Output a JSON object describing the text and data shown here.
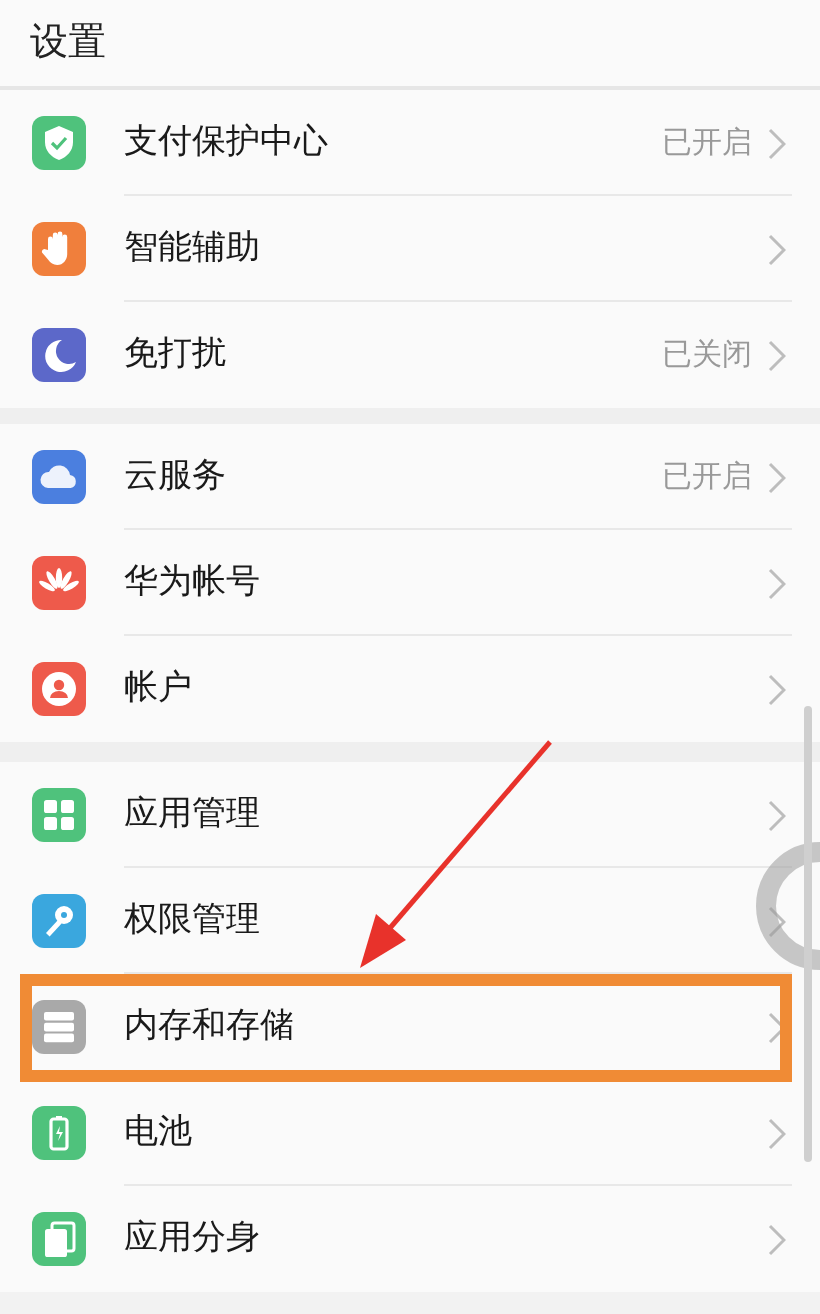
{
  "title": "设置",
  "groups": [
    {
      "items": [
        {
          "label": "支付保护中心",
          "status": "已开启",
          "kind": "shield",
          "color": "#4fc27c",
          "highlighted": false
        },
        {
          "label": "智能辅助",
          "kind": "hand",
          "color": "#f07f3c",
          "highlighted": false
        },
        {
          "label": "免打扰",
          "status": "已关闭",
          "kind": "moon",
          "color": "#5c68c9",
          "highlighted": false
        }
      ]
    },
    {
      "items": [
        {
          "label": "云服务",
          "status": "已开启",
          "kind": "cloud",
          "color": "#4b7fdf",
          "highlighted": false
        },
        {
          "label": "华为帐号",
          "kind": "petals",
          "color": "#ee5a4b",
          "highlighted": false
        },
        {
          "label": "帐户",
          "kind": "person",
          "color": "#ee5a4b",
          "highlighted": false
        }
      ]
    },
    {
      "items": [
        {
          "label": "应用管理",
          "kind": "grid",
          "color": "#4fc27c",
          "highlighted": false
        },
        {
          "label": "权限管理",
          "kind": "key",
          "color": "#3aa7de",
          "highlighted": false
        },
        {
          "label": "内存和存储",
          "kind": "storage",
          "color": "#a9a9a9",
          "highlighted": true
        },
        {
          "label": "电池",
          "kind": "battery",
          "color": "#4fc27c",
          "highlighted": false
        },
        {
          "label": "应用分身",
          "kind": "clone",
          "color": "#4fc27c",
          "highlighted": false
        }
      ]
    }
  ]
}
